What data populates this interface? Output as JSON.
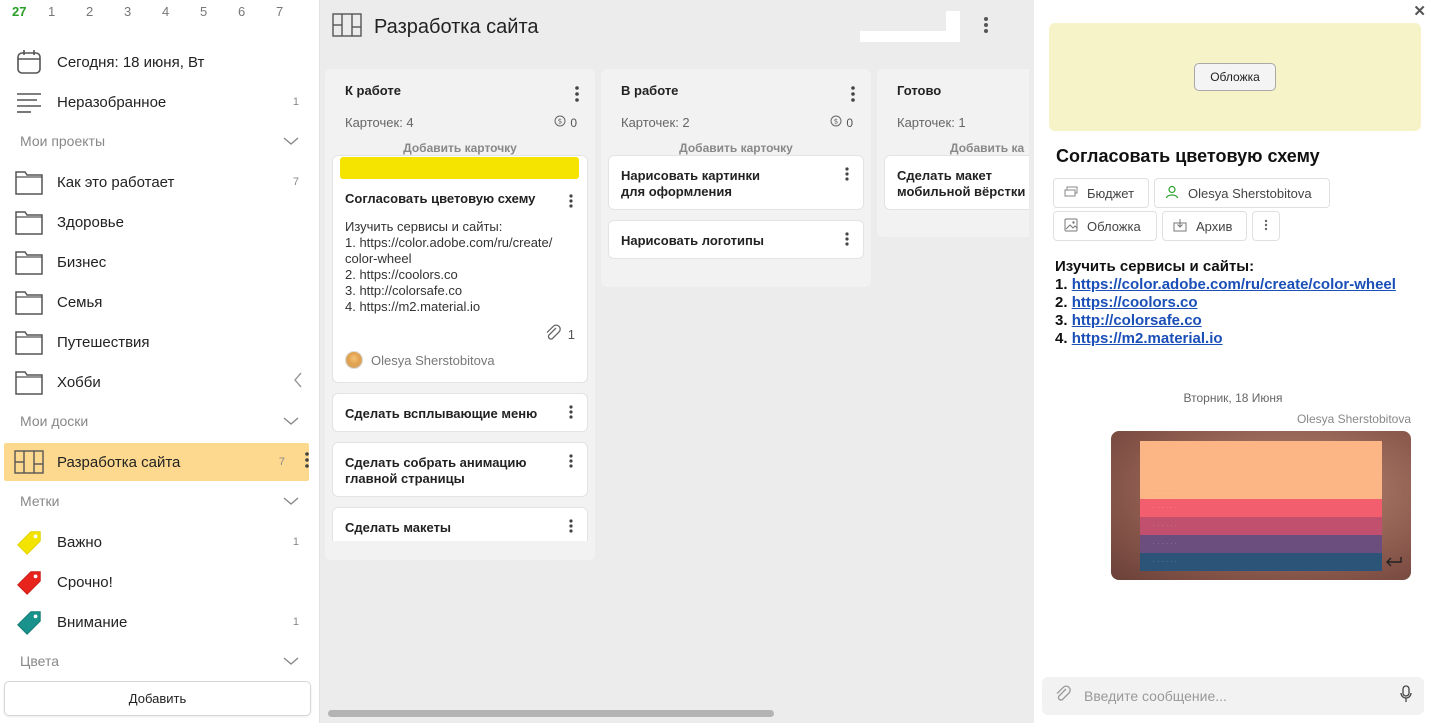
{
  "sidebar": {
    "date_strip": [
      "27",
      "1",
      "2",
      "3",
      "4",
      "5",
      "6",
      "7"
    ],
    "today": "Сегодня: 18 июня, Вт",
    "unsorted": {
      "label": "Неразобранное",
      "count": "1"
    },
    "projects_header": "Мои проекты",
    "projects": [
      {
        "label": "Как это работает",
        "count": "7"
      },
      {
        "label": "Здоровье",
        "count": ""
      },
      {
        "label": "Бизнес",
        "count": ""
      },
      {
        "label": "Семья",
        "count": ""
      },
      {
        "label": "Путешествия",
        "count": ""
      },
      {
        "label": "Хобби",
        "count": ""
      }
    ],
    "boards_header": "Мои доски",
    "active_board": {
      "label": "Разработка сайта",
      "count": "7"
    },
    "labels_header": "Метки",
    "labels": [
      {
        "label": "Важно",
        "count": "1",
        "color": "#f2e400"
      },
      {
        "label": "Срочно!",
        "count": "",
        "color": "#e8231c"
      },
      {
        "label": "Внимание",
        "count": "1",
        "color": "#18928a"
      }
    ],
    "colors_header": "Цвета",
    "add_button": "Добавить"
  },
  "board": {
    "title": "Разработка сайта",
    "columns": [
      {
        "title": "К работе",
        "count": "Карточек: 4",
        "budget": "0",
        "add": "Добавить карточку",
        "cards": [
          {
            "title": "Согласовать цветовую схему",
            "desc": [
              "Изучить сервисы и сайты:",
              "1. https://color.adobe.com/ru/create/",
              "color-wheel",
              "2. https://coolors.co",
              "3. http://colorsafe.co",
              "4. https://m2.material.io"
            ],
            "attachments": "1",
            "user": "Olesya Sherstobitova"
          },
          {
            "title": "Сделать всплывающие меню"
          },
          {
            "title": "Сделать собрать анимацию главной страницы"
          },
          {
            "title": "Сделать макеты"
          }
        ]
      },
      {
        "title": "В работе",
        "count": "Карточек: 2",
        "budget": "0",
        "add": "Добавить карточку",
        "cards": [
          {
            "title": "Нарисовать картинки для оформления"
          },
          {
            "title": "Нарисовать логотипы"
          }
        ]
      },
      {
        "title": "Готово",
        "count": "Карточек: 1",
        "budget": "",
        "add": "Добавить ка",
        "cards": [
          {
            "title": "Сделать макет мобильной вёрстки"
          }
        ]
      }
    ]
  },
  "panel": {
    "cover_button": "Обложка",
    "title": "Согласовать цветовую схему",
    "buttons": {
      "budget": "Бюджет",
      "user": "Olesya Sherstobitova",
      "cover": "Обложка",
      "archive": "Архив"
    },
    "desc_intro": "Изучить сервисы и сайты:",
    "links": [
      {
        "num": "1.",
        "url": "https://color.adobe.com/ru/create/color-wheel"
      },
      {
        "num": "2.",
        "url": "https://coolors.co"
      },
      {
        "num": "3.",
        "url": "http://colorsafe.co"
      },
      {
        "num": "4.",
        "url": "https://m2.material.io"
      }
    ],
    "day_separator": "Вторник, 18 Июня",
    "message_author": "Olesya Sherstobitova",
    "palette": [
      "#fcb584",
      "#f25e6e",
      "#c0506e",
      "#6c4e7e",
      "#2c5478"
    ],
    "composer_placeholder": "Введите сообщение..."
  },
  "colors": {
    "accent_active": "#fdd98f",
    "today_green": "#2aa02a",
    "link": "#1a4fb8"
  }
}
